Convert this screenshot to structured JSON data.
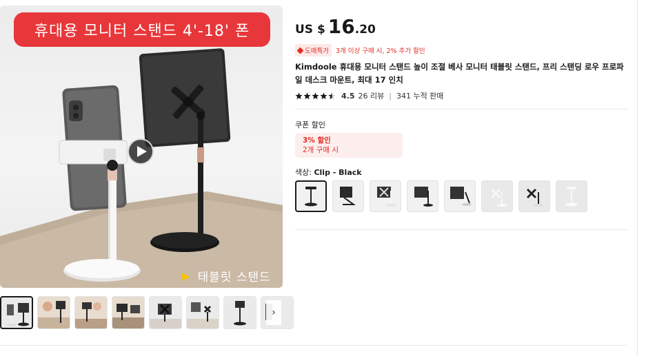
{
  "gallery": {
    "banner_text": "휴대용 모니터 스탠드 4'-18' 폰",
    "caption": "태블릿 스탠드",
    "caption_icon": "play-triangle-icon",
    "play_icon": "play-icon",
    "next_icon": "chevron-right-icon",
    "next_glyph": "›",
    "thumbnail_count": 8
  },
  "product": {
    "price": {
      "currency": "US $",
      "integer": "16",
      "decimal": ".20"
    },
    "promo": {
      "tag": "도매특가",
      "text": "3개 이상 구매 시, 2% 추가 할인"
    },
    "title": "Kimdoole 휴대용 모니터 스탠드 높이 조절 베사 모니터 태블릿 스탠드, 프리 스탠딩 로우 프로파일 데스크 마운트, 최대 17 인치",
    "rating": {
      "stars": 4.5,
      "score": "4.5",
      "reviews": "26 리뷰",
      "separator": "|",
      "sold": "341 누적 판매"
    },
    "coupon": {
      "label": "쿠폰 할인",
      "discount": "3% 할인",
      "condition": "2개 구매 시"
    },
    "color": {
      "label": "색상: ",
      "value": "Clip - Black"
    },
    "swatch_count": 8
  },
  "colors": {
    "accent_red": "#e02e24",
    "banner_red": "#e8373a",
    "star": "#191919",
    "caption_arrow": "#f5c200"
  }
}
